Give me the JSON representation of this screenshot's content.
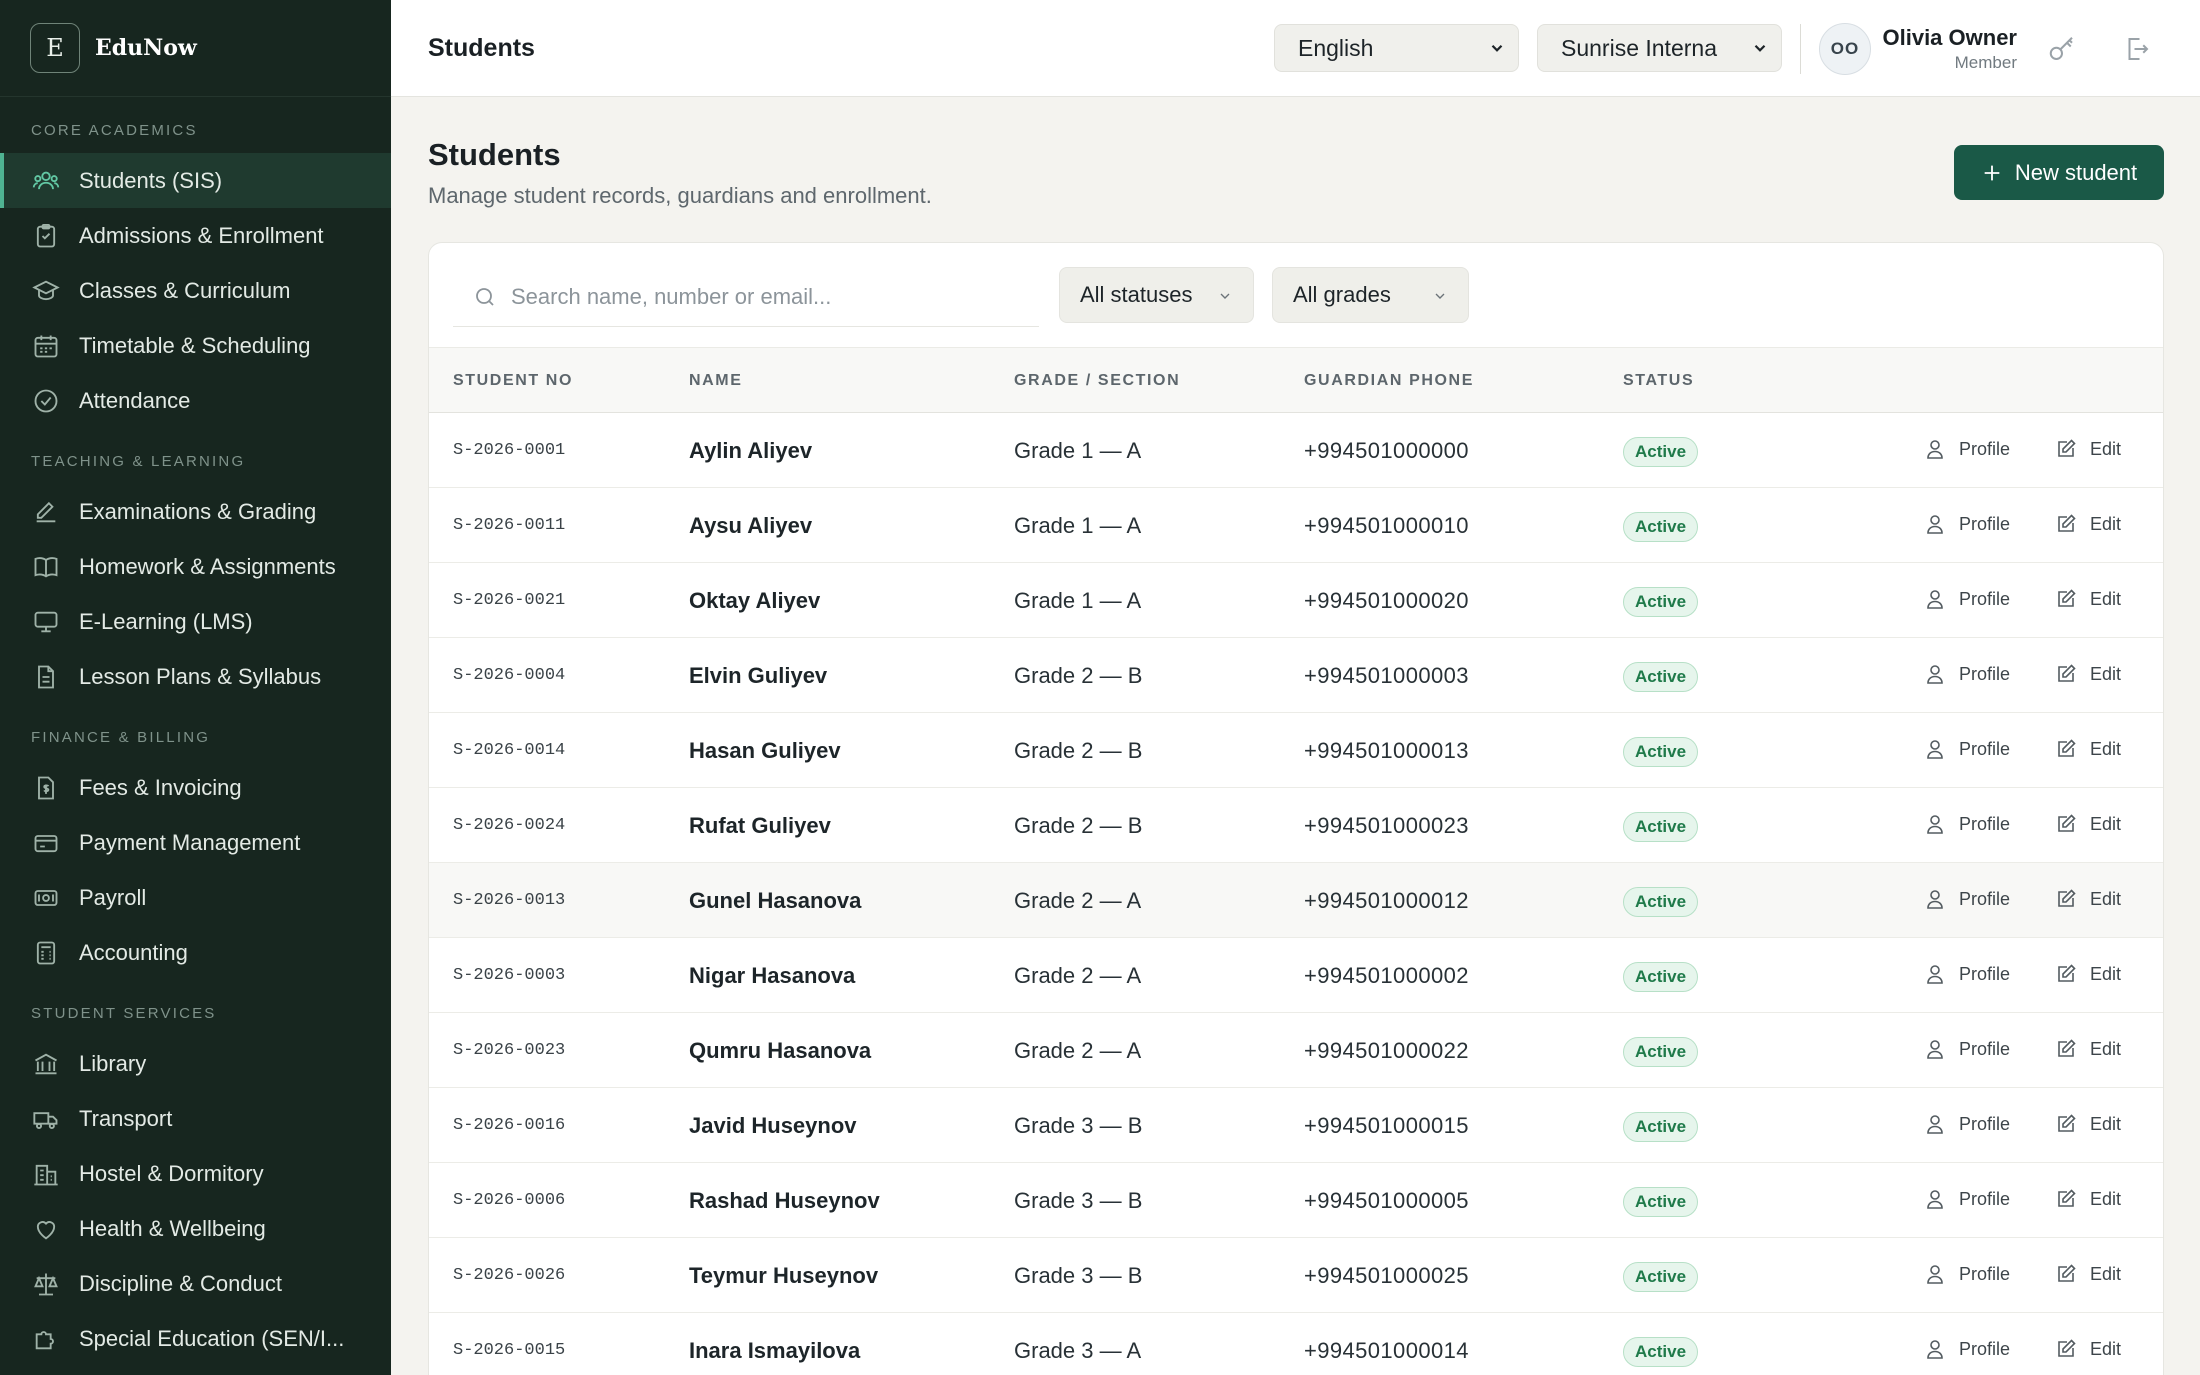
{
  "app": {
    "logo_letter": "E",
    "name": "EduNow"
  },
  "sidebar": {
    "sections": [
      {
        "title": "CORE ACADEMICS",
        "items": [
          {
            "label": "Students (SIS)",
            "icon": "users-icon",
            "active": true
          },
          {
            "label": "Admissions & Enrollment",
            "icon": "clipboard-icon"
          },
          {
            "label": "Classes & Curriculum",
            "icon": "graduation-cap-icon"
          },
          {
            "label": "Timetable & Scheduling",
            "icon": "calendar-icon"
          },
          {
            "label": "Attendance",
            "icon": "check-circle-icon"
          }
        ]
      },
      {
        "title": "TEACHING & LEARNING",
        "items": [
          {
            "label": "Examinations & Grading",
            "icon": "pencil-square-icon"
          },
          {
            "label": "Homework & Assignments",
            "icon": "book-open-icon"
          },
          {
            "label": "E-Learning (LMS)",
            "icon": "monitor-icon"
          },
          {
            "label": "Lesson Plans & Syllabus",
            "icon": "document-icon"
          }
        ]
      },
      {
        "title": "FINANCE & BILLING",
        "items": [
          {
            "label": "Fees & Invoicing",
            "icon": "invoice-icon"
          },
          {
            "label": "Payment Management",
            "icon": "credit-card-icon"
          },
          {
            "label": "Payroll",
            "icon": "banknote-icon"
          },
          {
            "label": "Accounting",
            "icon": "calculator-icon"
          }
        ]
      },
      {
        "title": "STUDENT SERVICES",
        "items": [
          {
            "label": "Library",
            "icon": "library-icon"
          },
          {
            "label": "Transport",
            "icon": "truck-icon"
          },
          {
            "label": "Hostel & Dormitory",
            "icon": "building-icon"
          },
          {
            "label": "Health & Wellbeing",
            "icon": "heart-icon"
          },
          {
            "label": "Discipline & Conduct",
            "icon": "scale-icon"
          },
          {
            "label": "Special Education (SEN/I...",
            "icon": "puzzle-icon"
          }
        ]
      }
    ]
  },
  "topbar": {
    "title": "Students",
    "language": "English",
    "school": "Sunrise Interna",
    "user_initials": "OO",
    "user_name": "Olivia Owner",
    "user_role": "Member"
  },
  "main": {
    "title": "Students",
    "subtitle": "Manage student records, guardians and enrollment.",
    "new_button": "New student",
    "search_placeholder": "Search name, number or email...",
    "status_filter": "All statuses",
    "grade_filter": "All grades",
    "columns": [
      "STUDENT NO",
      "NAME",
      "GRADE / SECTION",
      "GUARDIAN PHONE",
      "STATUS"
    ],
    "action_profile": "Profile",
    "action_edit": "Edit",
    "rows": [
      {
        "no": "S-2026-0001",
        "name": "Aylin Aliyev",
        "grade": "Grade 1 — A",
        "phone": "+994501000000",
        "status": "Active"
      },
      {
        "no": "S-2026-0011",
        "name": "Aysu Aliyev",
        "grade": "Grade 1 — A",
        "phone": "+994501000010",
        "status": "Active"
      },
      {
        "no": "S-2026-0021",
        "name": "Oktay Aliyev",
        "grade": "Grade 1 — A",
        "phone": "+994501000020",
        "status": "Active"
      },
      {
        "no": "S-2026-0004",
        "name": "Elvin Guliyev",
        "grade": "Grade 2 — B",
        "phone": "+994501000003",
        "status": "Active"
      },
      {
        "no": "S-2026-0014",
        "name": "Hasan Guliyev",
        "grade": "Grade 2 — B",
        "phone": "+994501000013",
        "status": "Active"
      },
      {
        "no": "S-2026-0024",
        "name": "Rufat Guliyev",
        "grade": "Grade 2 — B",
        "phone": "+994501000023",
        "status": "Active"
      },
      {
        "no": "S-2026-0013",
        "name": "Gunel Hasanova",
        "grade": "Grade 2 — A",
        "phone": "+994501000012",
        "status": "Active"
      },
      {
        "no": "S-2026-0003",
        "name": "Nigar Hasanova",
        "grade": "Grade 2 — A",
        "phone": "+994501000002",
        "status": "Active"
      },
      {
        "no": "S-2026-0023",
        "name": "Qumru Hasanova",
        "grade": "Grade 2 — A",
        "phone": "+994501000022",
        "status": "Active"
      },
      {
        "no": "S-2026-0016",
        "name": "Javid Huseynov",
        "grade": "Grade 3 — B",
        "phone": "+994501000015",
        "status": "Active"
      },
      {
        "no": "S-2026-0006",
        "name": "Rashad Huseynov",
        "grade": "Grade 3 — B",
        "phone": "+994501000005",
        "status": "Active"
      },
      {
        "no": "S-2026-0026",
        "name": "Teymur Huseynov",
        "grade": "Grade 3 — B",
        "phone": "+994501000025",
        "status": "Active"
      },
      {
        "no": "S-2026-0015",
        "name": "Inara Ismayilova",
        "grade": "Grade 3 — A",
        "phone": "+994501000014",
        "status": "Active"
      }
    ]
  },
  "colors": {
    "sidebar_bg": "#17261f",
    "accent": "#1a5947",
    "active_badge": "#1f7a4a"
  }
}
